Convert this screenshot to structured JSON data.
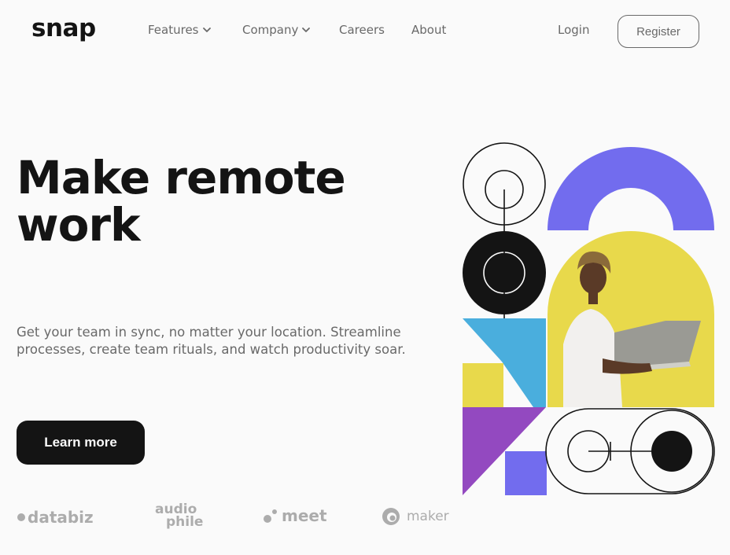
{
  "brand": {
    "logo": "snap"
  },
  "nav": {
    "features": "Features",
    "company": "Company",
    "careers": "Careers",
    "about": "About",
    "login": "Login",
    "register": "Register"
  },
  "hero": {
    "title_line1": "Make remote",
    "title_line2": "work",
    "description": "Get your team in sync, no matter your location. Streamline processes, create team rituals, and watch productivity soar.",
    "cta": "Learn more"
  },
  "clients": {
    "databiz": "databiz",
    "audiophile_top": "audio",
    "audiophile_bottom": "phile",
    "meet": "meet",
    "maker": "maker"
  },
  "colors": {
    "background": "#fafafa",
    "text_dark": "#141414",
    "text_gray": "#696969",
    "logo_gray": "#acacac",
    "purple_arch": "#726cee",
    "yellow": "#e8d94b",
    "blue": "#4aaedd",
    "violet": "#9349c0"
  },
  "icons": {
    "chevron": "chevron-down-icon"
  }
}
